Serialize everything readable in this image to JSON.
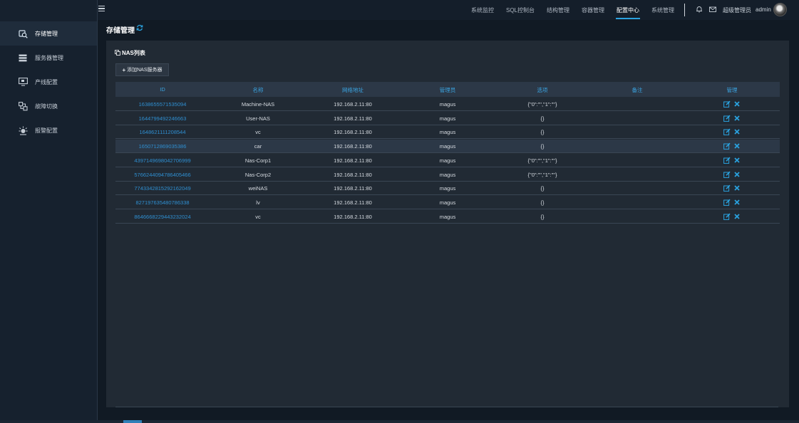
{
  "sidebar": {
    "items": [
      {
        "label": "存储管理",
        "icon": "storage-search-icon",
        "active": true
      },
      {
        "label": "服务器管理",
        "icon": "server-list-icon",
        "active": false
      },
      {
        "label": "产线配置",
        "icon": "monitor-icon",
        "active": false
      },
      {
        "label": "故障切换",
        "icon": "failover-icon",
        "active": false
      },
      {
        "label": "报警配置",
        "icon": "alarm-icon",
        "active": false
      }
    ]
  },
  "topnav": {
    "items": [
      {
        "label": "系统监控"
      },
      {
        "label": "SQL控制台"
      },
      {
        "label": "结构管理"
      },
      {
        "label": "容器管理"
      },
      {
        "label": "配置中心"
      },
      {
        "label": "系统管理"
      }
    ],
    "active": "配置中心",
    "user_role": "超级管理员",
    "user_name": "admin"
  },
  "page": {
    "title": "存储管理",
    "section_title": "NAS列表",
    "add_button_label": "添加NAS服务器"
  },
  "table": {
    "columns": [
      "ID",
      "名称",
      "网络地址",
      "管理员",
      "选项",
      "备注",
      "管理"
    ],
    "rows": [
      {
        "id": "1638655571535094",
        "name": "Machine-NAS",
        "address": "192.168.2.11:80",
        "admin": "magus",
        "options": "{\"0\":\"\",\"1\":\"\"}",
        "note": ""
      },
      {
        "id": "1644799492246663",
        "name": "User-NAS",
        "address": "192.168.2.11:80",
        "admin": "magus",
        "options": "{}",
        "note": ""
      },
      {
        "id": "1648621111208544",
        "name": "vc",
        "address": "192.168.2.11:80",
        "admin": "magus",
        "options": "{}",
        "note": ""
      },
      {
        "id": "1650712869035386",
        "name": "car",
        "address": "192.168.2.11:80",
        "admin": "magus",
        "options": "{}",
        "note": ""
      },
      {
        "id": "4397149698042706999",
        "name": "Nas-Corp1",
        "address": "192.168.2.11:80",
        "admin": "magus",
        "options": "{\"0\":\"\",\"1\":\"\"}",
        "note": ""
      },
      {
        "id": "5766244094786405466",
        "name": "Nas-Corp2",
        "address": "192.168.2.11:80",
        "admin": "magus",
        "options": "{\"0\":\"\",\"1\":\"\"}",
        "note": ""
      },
      {
        "id": "7743342815292162049",
        "name": "weiNAS",
        "address": "192.168.2.11:80",
        "admin": "magus",
        "options": "{}",
        "note": ""
      },
      {
        "id": "827197635480786338",
        "name": "lv",
        "address": "192.168.2.11:80",
        "admin": "magus",
        "options": "{}",
        "note": ""
      },
      {
        "id": "8646668229443232024",
        "name": "vc",
        "address": "192.168.2.11:80",
        "admin": "magus",
        "options": "{}",
        "note": ""
      }
    ]
  },
  "colors": {
    "accent": "#2aa2df",
    "link": "#2f8fd1",
    "background": "#111a24",
    "panel": "#212a34"
  }
}
